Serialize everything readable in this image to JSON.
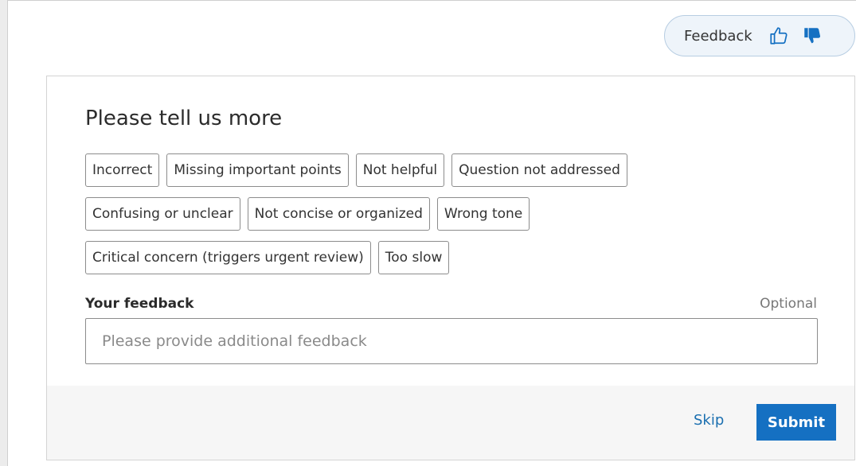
{
  "feedback_pill": {
    "label": "Feedback",
    "thumbs_up_icon": "thumbs-up-outline-icon",
    "thumbs_down_icon": "thumbs-down-filled-icon",
    "accent_color": "#1570c2"
  },
  "panel": {
    "title": "Please tell us more",
    "tag_rows": [
      [
        "Incorrect",
        "Missing important points",
        "Not helpful",
        "Question not addressed"
      ],
      [
        "Confusing or unclear",
        "Not concise or organized",
        "Wrong tone"
      ],
      [
        "Critical concern (triggers urgent review)",
        "Too slow"
      ]
    ],
    "feedback_field": {
      "label": "Your feedback",
      "optional_label": "Optional",
      "value": "",
      "placeholder": "Please provide additional feedback"
    },
    "skip_label": "Skip",
    "submit_label": "Submit"
  }
}
